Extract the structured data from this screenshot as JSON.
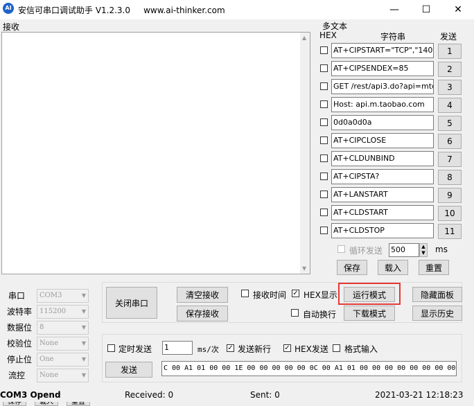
{
  "window": {
    "app_icon": "AI",
    "title": "安信可串口调试助手 V1.2.3.0     www.ai-thinker.com",
    "minimize": "—",
    "maximize": "☐",
    "close": "✕"
  },
  "receive": {
    "label": "接收"
  },
  "multitext": {
    "title": "多文本",
    "col_hex": "HEX",
    "col_string": "字符串",
    "col_send": "发送",
    "rows": [
      {
        "text": "AT+CIPSTART=\"TCP\",\"140",
        "num": "1"
      },
      {
        "text": "AT+CIPSENDEX=85",
        "num": "2"
      },
      {
        "text": "GET /rest/api3.do?api=mtc",
        "num": "3"
      },
      {
        "text": "Host: api.m.taobao.com",
        "num": "4"
      },
      {
        "text": "0d0a0d0a",
        "num": "5"
      },
      {
        "text": "AT+CIPCLOSE",
        "num": "6"
      },
      {
        "text": "AT+CLDUNBIND",
        "num": "7"
      },
      {
        "text": "AT+CIPSTA?",
        "num": "8"
      },
      {
        "text": "AT+LANSTART",
        "num": "9"
      },
      {
        "text": "AT+CLDSTART",
        "num": "10"
      },
      {
        "text": "AT+CLDSTOP",
        "num": "11"
      }
    ],
    "loop_label": "循环发送",
    "loop_value": "500",
    "loop_unit": "ms",
    "save": "保存",
    "load": "载入",
    "reset": "重置"
  },
  "port": {
    "port_label": "串口",
    "port_value": "COM3",
    "baud_label": "波特率",
    "baud_value": "115200",
    "data_label": "数据位",
    "data_value": "8",
    "parity_label": "校验位",
    "parity_value": "None",
    "stop_label": "停止位",
    "stop_value": "One",
    "flow_label": "流控",
    "flow_value": "None"
  },
  "controls": {
    "close_port": "关闭串口",
    "clear_recv": "清空接收",
    "save_recv": "保存接收",
    "recv_time": "接收时间",
    "hex_display": "HEX显示",
    "auto_wrap": "自动换行",
    "run_mode": "运行模式",
    "download_mode": "下载模式",
    "hide_panel": "隐藏面板",
    "show_history": "显示历史"
  },
  "send": {
    "timed_send": "定时发送",
    "interval": "1",
    "interval_unit": "ms/次",
    "send_newline": "发送新行",
    "hex_send": "HEX发送",
    "format_input": "格式输入",
    "send_button": "发送",
    "payload": "C 00 A1 01 00 00 1E 00 00 00 00 00 0C 00 A1 01 00 00 00 00 00 00 00 00"
  },
  "status": {
    "port_state": "COM3 Opend",
    "received": "Received: 0",
    "sent": "Sent: 0",
    "datetime": "2021-03-21 12:18:23"
  },
  "bottom_tabs": [
    "保存",
    "载入",
    "重置"
  ]
}
